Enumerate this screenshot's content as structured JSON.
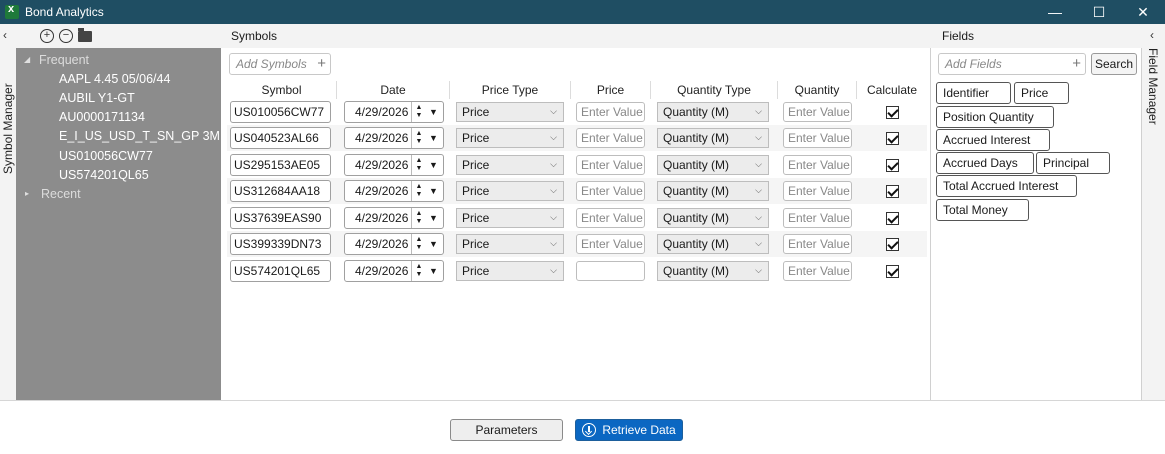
{
  "window": {
    "title": "Bond Analytics",
    "controls": [
      "—",
      "☐",
      "✕"
    ]
  },
  "left_strip": {
    "label": "Symbol Manager",
    "collapse_glyph": "‹"
  },
  "right_strip": {
    "label": "Field Manager",
    "collapse_glyph": "‹"
  },
  "symbol_manager": {
    "groups": [
      {
        "label": "Frequent",
        "expanded": true,
        "arrow": "◢",
        "items": [
          "AAPL 4.45 05/06/44",
          "AUBIL Y1-GT",
          "AU0000171134",
          "E_I_US_USD_T_SN_GP 3M",
          "US010056CW77",
          "US574201QL65"
        ]
      },
      {
        "label": "Recent",
        "expanded": false,
        "arrow": "▸",
        "items": []
      }
    ]
  },
  "symbols": {
    "heading": "Symbols",
    "add_placeholder": "Add Symbols",
    "add_glyph": "+",
    "columns": [
      "Symbol",
      "Date",
      "Price Type",
      "Price",
      "Quantity Type",
      "Quantity",
      "Calculate"
    ],
    "rows": [
      {
        "symbol": "US010056CW77",
        "date": "4/29/2026",
        "price_type": "Price",
        "price": "Enter Value",
        "quantity_type": "Quantity (M)",
        "quantity": "Enter Value",
        "calculate": true
      },
      {
        "symbol": "US040523AL66",
        "date": "4/29/2026",
        "price_type": "Price",
        "price": "Enter Value",
        "quantity_type": "Quantity (M)",
        "quantity": "Enter Value",
        "calculate": true
      },
      {
        "symbol": "US295153AE05",
        "date": "4/29/2026",
        "price_type": "Price",
        "price": "Enter Value",
        "quantity_type": "Quantity (M)",
        "quantity": "Enter Value",
        "calculate": true
      },
      {
        "symbol": "US312684AA18",
        "date": "4/29/2026",
        "price_type": "Price",
        "price": "Enter Value",
        "quantity_type": "Quantity (M)",
        "quantity": "Enter Value",
        "calculate": true
      },
      {
        "symbol": "US37639EAS90",
        "date": "4/29/2026",
        "price_type": "Price",
        "price": "Enter Value",
        "quantity_type": "Quantity (M)",
        "quantity": "Enter Value",
        "calculate": true
      },
      {
        "symbol": "US399339DN73",
        "date": "4/29/2026",
        "price_type": "Price",
        "price": "Enter Value",
        "quantity_type": "Quantity (M)",
        "quantity": "Enter Value",
        "calculate": true
      },
      {
        "symbol": "US574201QL65",
        "date": "4/29/2026",
        "price_type": "Price",
        "price": "",
        "quantity_type": "Quantity (M)",
        "quantity": "Enter Value",
        "calculate": true
      }
    ]
  },
  "fields": {
    "heading": "Fields",
    "add_placeholder": "Add Fields",
    "add_glyph": "+",
    "search_label": "Search",
    "chips": [
      "Identifier",
      "Price",
      "Position Quantity",
      "Accrued Interest",
      "Accrued Days",
      "Principal",
      "Total Accrued Interest",
      "Total Money"
    ]
  },
  "footer": {
    "parameters_label": "Parameters",
    "retrieve_label": "Retrieve Data"
  },
  "colors": {
    "titlebar": "#1f4e63",
    "accent": "#0b67c2",
    "tree_panel": "#8c8c8c"
  }
}
